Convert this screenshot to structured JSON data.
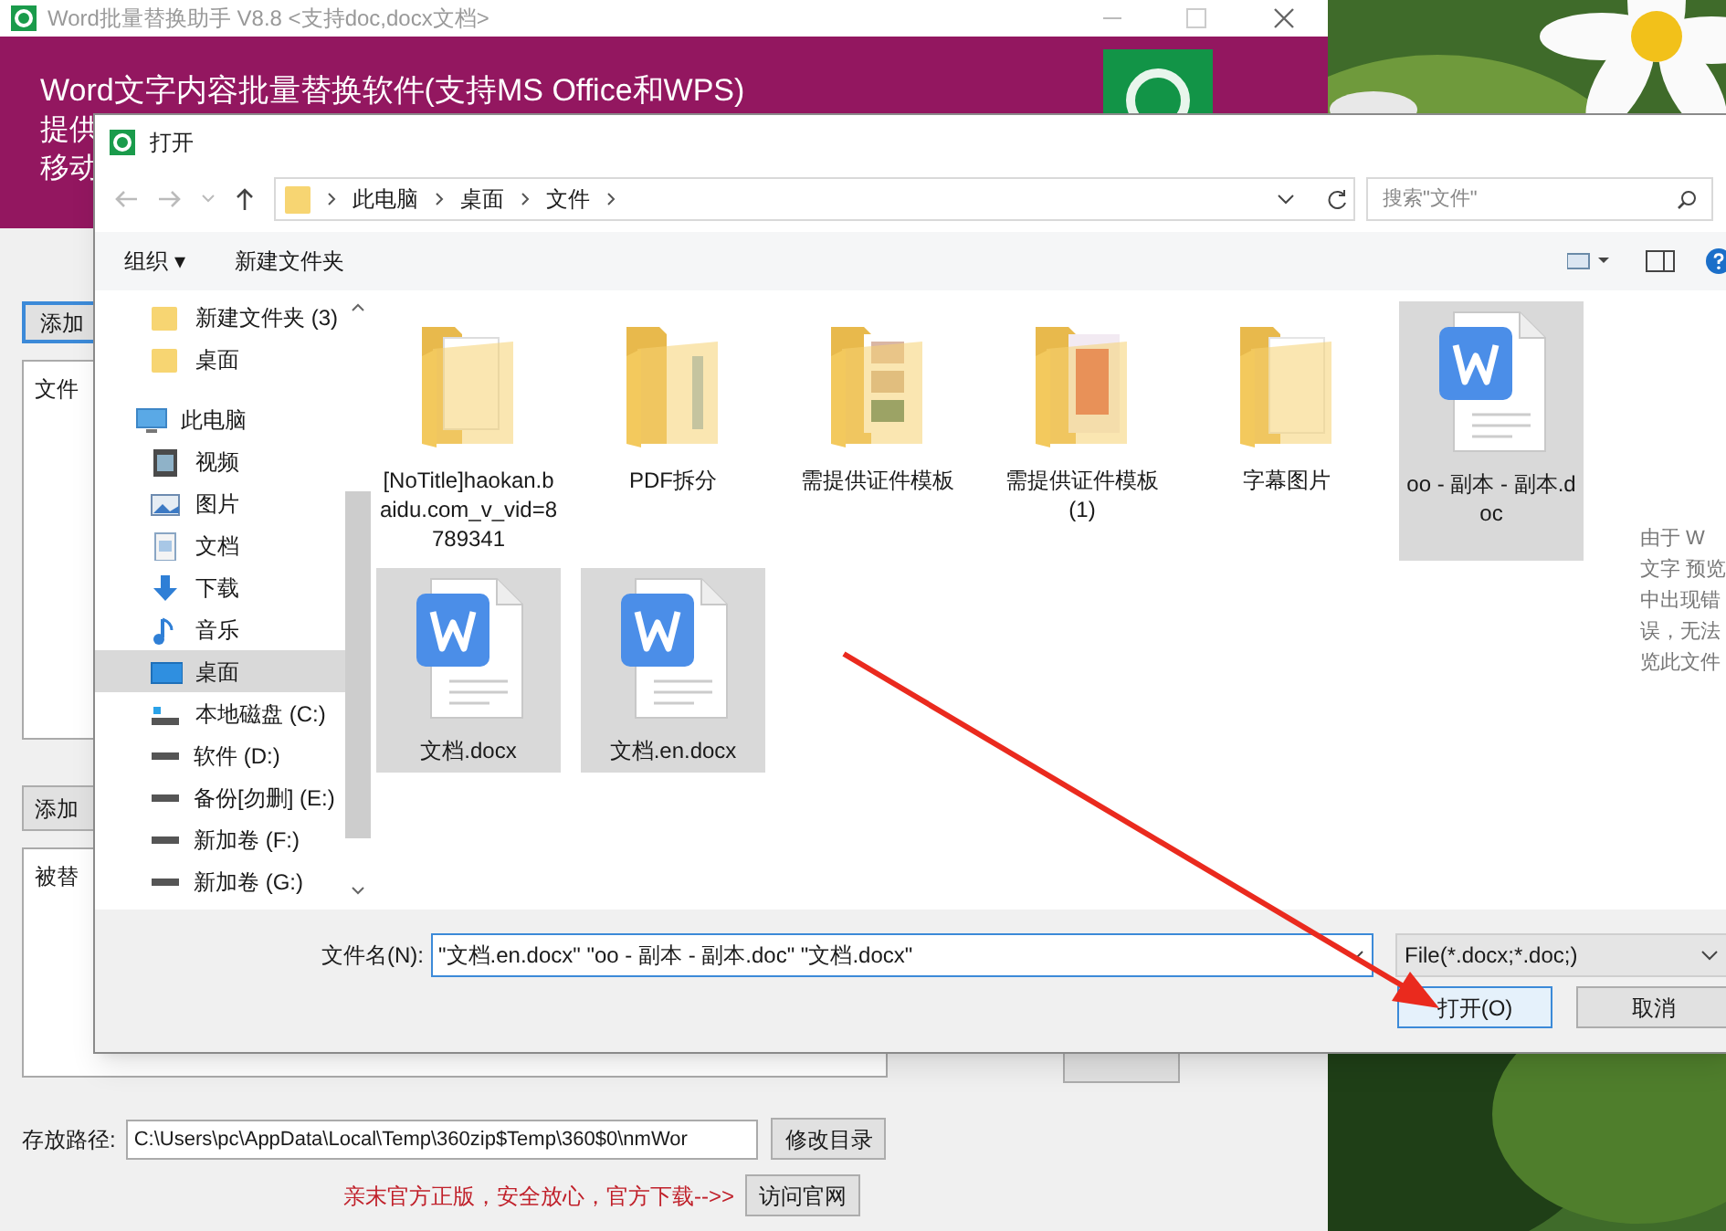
{
  "app": {
    "title": "Word批量替换助手   V8.8   <支持doc,docx文档>",
    "banner_lines": [
      "Word文字内容批量替换软件(支持MS Office和WPS)",
      "提供",
      "移动"
    ],
    "add_files_button": "添加",
    "file_list_header": "文件",
    "add_replace_button": "添加",
    "replace_list_header": "被替",
    "save_path_label": "存放路径:",
    "save_path": "C:\\Users\\pc\\AppData\\Local\\Temp\\360zip$Temp\\360$0\\nmWor",
    "change_dir_button": "修改目录",
    "promo_text": "亲末官方正版，安全放心，官方下载-->>",
    "visit_site_button": "访问官网"
  },
  "dialog": {
    "title": "打开",
    "breadcrumbs": [
      "此电脑",
      "桌面",
      "文件"
    ],
    "search": {
      "placeholder": "搜索\"文件\""
    },
    "toolbar": {
      "organize": "组织 ▾",
      "new_folder": "新建文件夹"
    },
    "nav": [
      {
        "label": "新建文件夹 (3)",
        "selected": false
      },
      {
        "label": "桌面",
        "selected": false
      },
      {
        "label": "此电脑",
        "selected": false,
        "children": [
          {
            "label": "视频",
            "selected": false
          },
          {
            "label": "图片",
            "selected": false
          },
          {
            "label": "文档",
            "selected": false
          },
          {
            "label": "下载",
            "selected": false
          },
          {
            "label": "音乐",
            "selected": false
          },
          {
            "label": "桌面",
            "selected": true
          },
          {
            "label": "本地磁盘 (C:)",
            "selected": false
          },
          {
            "label": "软件 (D:)",
            "selected": false
          },
          {
            "label": "备份[勿删] (E:)",
            "selected": false
          },
          {
            "label": "新加卷 (F:)",
            "selected": false
          },
          {
            "label": "新加卷 (G:)",
            "selected": false
          }
        ]
      }
    ],
    "files": [
      {
        "name": "[NoTitle]haokan.baidu.com_v_vid=8789341",
        "kind": "folder",
        "selected": false
      },
      {
        "name": "PDF拆分",
        "kind": "folder",
        "selected": false
      },
      {
        "name": "需提供证件模板",
        "kind": "folder",
        "selected": false
      },
      {
        "name": "需提供证件模板 (1)",
        "kind": "folder",
        "selected": false
      },
      {
        "name": "字幕图片",
        "kind": "folder",
        "selected": false
      },
      {
        "name": "oo - 副本 - 副本.doc",
        "kind": "word",
        "selected": true
      },
      {
        "name": "文档.docx",
        "kind": "word",
        "selected": true
      },
      {
        "name": "文档.en.docx",
        "kind": "word",
        "selected": true
      }
    ],
    "preview_lines": [
      "由于 W",
      "文字 预览",
      "中出现错",
      "误，无法",
      "览此文件"
    ],
    "filename_label": "文件名(N):",
    "filename": "\"文档.en.docx\" \"oo - 副本 - 副本.doc\" \"文档.docx\"",
    "filter": "File(*.docx;*.doc;)",
    "open_button": "打开(O)",
    "cancel_button": "取消"
  }
}
